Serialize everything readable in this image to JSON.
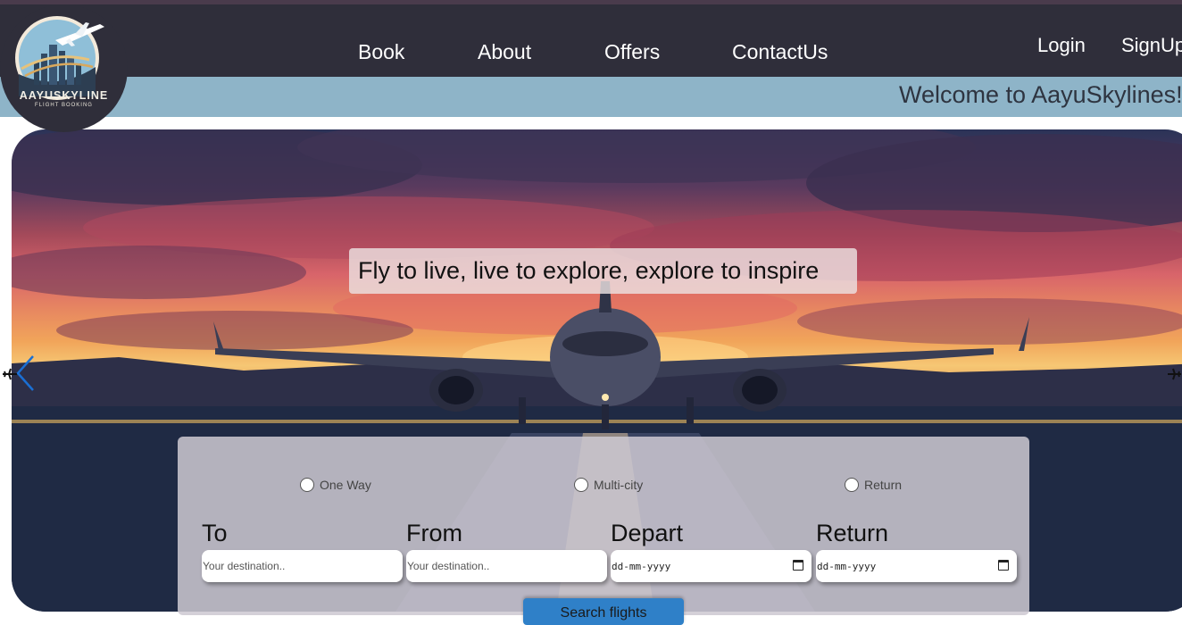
{
  "nav": {
    "links": [
      "Book",
      "About",
      "Offers",
      "ContactUs"
    ],
    "login": "Login",
    "signup": "SignUp"
  },
  "logo": {
    "name": "AAYUSKYLINE",
    "subtitle": "FLIGHT BOOKING"
  },
  "marquee": {
    "text": "Welcome to AayuSkylines!"
  },
  "hero": {
    "tagline": "Fly to live, live to explore, explore to inspire"
  },
  "search": {
    "trip_types": [
      "One Way",
      "Multi-city",
      "Return"
    ],
    "to_label": "To",
    "to_placeholder": "Your destination..",
    "from_label": "From",
    "from_placeholder": "Your destination..",
    "depart_label": "Depart",
    "depart_value": "dd-mm-yyyy",
    "return_label": "Return",
    "return_value": "dd-mm-yyyy",
    "button_label": "Search flights"
  },
  "colors": {
    "navbar": "#2f2e3a",
    "marquee_bar": "#8eb4c8",
    "search_button": "#2f80c8"
  }
}
